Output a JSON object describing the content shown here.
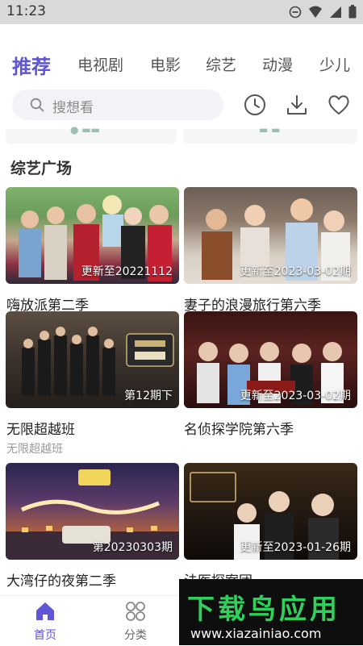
{
  "status_bar": {
    "time": "11:23"
  },
  "tabs": [
    {
      "label": "推荐",
      "active": true
    },
    {
      "label": "电视剧",
      "active": false
    },
    {
      "label": "电影",
      "active": false
    },
    {
      "label": "综艺",
      "active": false
    },
    {
      "label": "动漫",
      "active": false
    },
    {
      "label": "少儿",
      "active": false
    }
  ],
  "search": {
    "placeholder": "搜想看"
  },
  "toolbar_icons": [
    "history-icon",
    "download-icon",
    "favorite-icon"
  ],
  "section": {
    "title": "综艺广场"
  },
  "items": [
    {
      "title": "嗨放派第二季",
      "badge": "更新至20221112",
      "subtitle": ""
    },
    {
      "title": "妻子的浪漫旅行第六季",
      "badge": "更新至2023-03-02期",
      "subtitle": ""
    },
    {
      "title": "无限超越班",
      "badge": "第12期下",
      "subtitle": "无限超越班"
    },
    {
      "title": "名侦探学院第六季",
      "badge": "更新至2023-03-02期",
      "subtitle": ""
    },
    {
      "title": "大湾仔的夜第二季",
      "badge": "第20230303期",
      "subtitle": ""
    },
    {
      "title": "法医探案团",
      "badge": "更新至2023-01-26期",
      "subtitle": ""
    }
  ],
  "bottom_nav": [
    {
      "label": "首页",
      "active": true
    },
    {
      "label": "分类",
      "active": false
    }
  ],
  "watermark": {
    "text": "下载鸟应用",
    "url": "www.xiazainiao.com"
  },
  "colors": {
    "accent": "#5f56d6",
    "watermark_green": "#2fd05b"
  }
}
